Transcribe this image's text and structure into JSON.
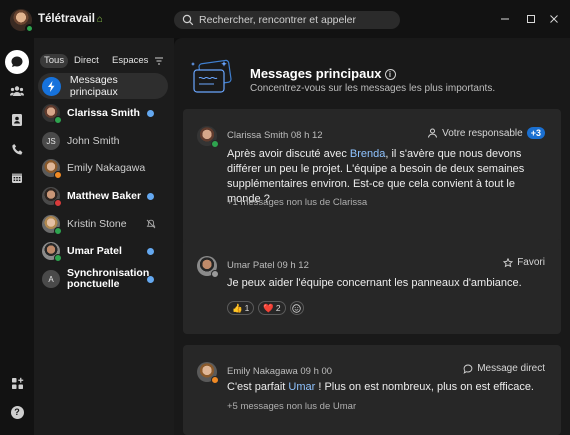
{
  "window": {
    "status": "Télétravail",
    "search_placeholder": "Rechercher, rencontrer et appeler"
  },
  "rail": {
    "items": [
      "messaging-icon",
      "teams-icon",
      "contacts-icon",
      "calling-icon",
      "calendar-icon"
    ],
    "bottom": [
      "apps-icon",
      "help-icon"
    ],
    "help_label": "?"
  },
  "sidebar": {
    "filters": [
      "Tous",
      "Direct",
      "Espaces"
    ],
    "main_space": "Messages principaux",
    "conversations": [
      {
        "name": "Clarissa Smith",
        "bold": true,
        "presence": "green",
        "unread": true
      },
      {
        "name": "John Smith",
        "initials": "JS",
        "bold": false,
        "unread": false
      },
      {
        "name": "Emily Nakagawa",
        "bold": false,
        "presence": "orange",
        "unread": false
      },
      {
        "name": "Matthew Baker",
        "bold": true,
        "presence": "red",
        "unread": true
      },
      {
        "name": "Kristin Stone",
        "bold": false,
        "presence": "green",
        "muted": true
      },
      {
        "name": "Umar Patel",
        "bold": true,
        "presence": "green",
        "unread": true
      },
      {
        "name_line1": "Synchronisation",
        "name_line2": "ponctuelle",
        "initials": "A",
        "bold": true,
        "unread": true
      }
    ]
  },
  "main": {
    "title": "Messages principaux",
    "info_glyph": "i",
    "subtitle": "Concentrez-vous sur les messages les plus importants.",
    "cards": [
      {
        "sender": "Clarissa Smith",
        "time": "08 h 12",
        "tag": "Votre responsable",
        "tag_badge": "+3",
        "text_before": "Après avoir discuté avec ",
        "mention": "Brenda",
        "text_after": ", il s'avère que nous devons différer un peu le projet. L'équipe a besoin de deux semaines supplémentaires environ. Est-ce que cela convient à tout le monde ?",
        "footer": "+1 messages non lus de Clarissa"
      },
      {
        "sender": "Umar Patel",
        "time": "09 h 12",
        "tag": "Favori",
        "text": "Je peux aider l'équipe concernant les panneaux d'ambiance.",
        "reactions": [
          {
            "emoji": "👍",
            "count": "1"
          },
          {
            "emoji": "❤️",
            "count": "2"
          }
        ]
      },
      {
        "sender": "Emily Nakagawa",
        "time": "09 h 00",
        "tag": "Message direct",
        "text_before": "C'est parfait ",
        "mention": "Umar",
        "text_after": " ! Plus on est nombreux, plus on est efficace.",
        "footer": "+5 messages non lus de Umar"
      }
    ]
  },
  "colors": {
    "accent": "#1672dc",
    "unread_dot": "#64a8f0",
    "mention": "#8fc3ff",
    "card_bg": "#272727",
    "presence_green": "#2ea44f"
  }
}
